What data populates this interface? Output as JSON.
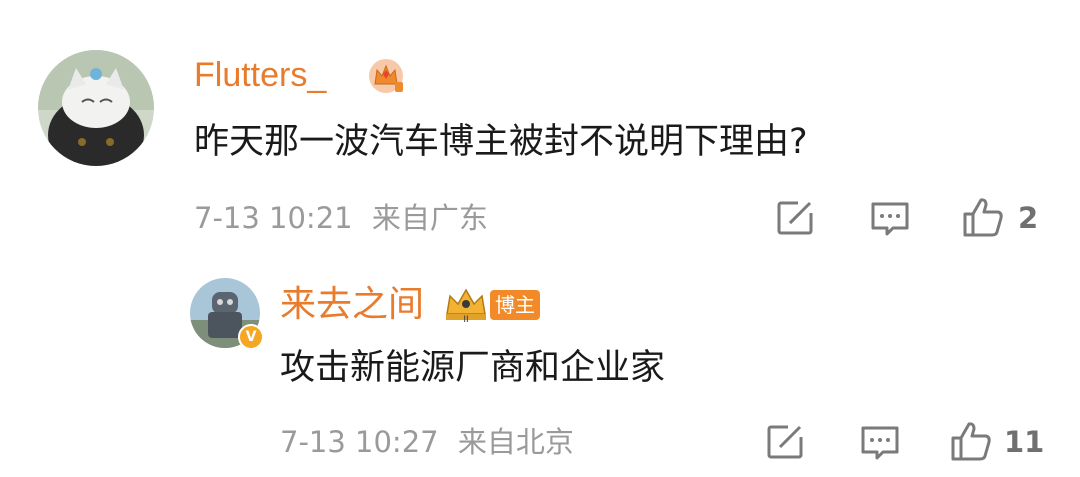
{
  "comments": [
    {
      "username": "Flutters_",
      "text": "昨天那一波汽车博主被封不说明下理由?",
      "time": "7-13 10:21",
      "location": "来自广东",
      "likes": "2",
      "badge_icon": "crown-level-icon"
    }
  ],
  "reply": {
    "username": "来去之间",
    "blogger_tag": "博主",
    "text": "攻击新能源厂商和企业家",
    "time": "7-13 10:27",
    "location": "来自北京",
    "likes": "11",
    "badge_icon": "crown-level-icon",
    "verified_mark": "V"
  },
  "colors": {
    "username": "#e87b2c",
    "text": "#1a1a1a",
    "meta": "#9a9a9a",
    "icon": "#7a7a7a",
    "verified": "#f5a623"
  }
}
